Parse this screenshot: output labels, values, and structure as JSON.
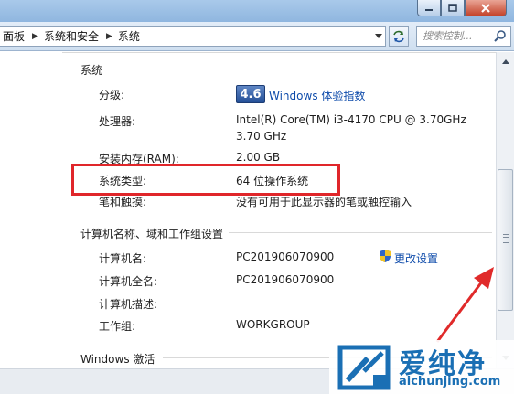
{
  "addressbar": {
    "crumbs": [
      "面板",
      "系统和安全",
      "系统"
    ],
    "search_placeholder": "搜索控制..."
  },
  "system": {
    "heading": "系统",
    "rating_label": "分级:",
    "rating_score": "4.6",
    "rating_link": "Windows 体验指数",
    "processor_label": "处理器:",
    "processor_line1": "Intel(R) Core(TM) i3-4170 CPU @ 3.70GHz",
    "processor_line2": "3.70 GHz",
    "ram_label": "安装内存(RAM):",
    "ram_value": "2.00 GB",
    "type_label": "系统类型:",
    "type_value": "64 位操作系统",
    "pen_label": "笔和触摸:",
    "pen_value": "没有可用于此显示器的笔或触控输入"
  },
  "computer": {
    "heading": "计算机名称、域和工作组设置",
    "name_label": "计算机名:",
    "name_value": "PC201906070900",
    "fullname_label": "计算机全名:",
    "fullname_value": "PC201906070900",
    "desc_label": "计算机描述:",
    "desc_value": "",
    "workgroup_label": "工作组:",
    "workgroup_value": "WORKGROUP",
    "change_link": "更改设置"
  },
  "activation": {
    "heading": "Windows 激活"
  },
  "watermark": {
    "title": "爱纯净",
    "url": "aichunjing.com"
  },
  "colors": {
    "accent_link": "#0f4cab",
    "highlight": "#e0262a",
    "wei_badge": "#2d5aa3"
  }
}
